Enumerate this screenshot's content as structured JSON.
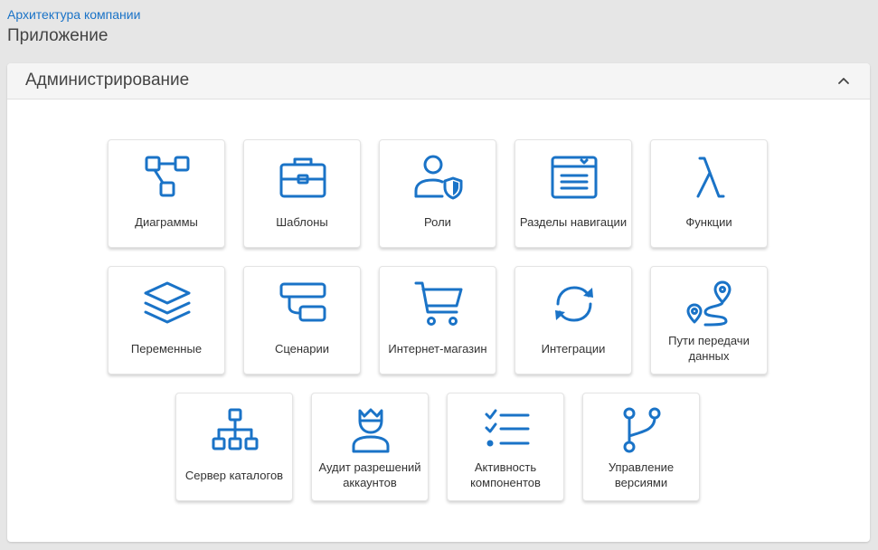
{
  "breadcrumb": "Архитектура компании",
  "page_title": "Приложение",
  "panel": {
    "title": "Администрирование",
    "toggle_icon": "chevron-up-icon"
  },
  "colors": {
    "accent": "#1a73c7",
    "background": "#e6e6e6",
    "panel_header": "#f5f5f5"
  },
  "tiles": [
    {
      "label": "Диаграммы",
      "icon": "diagram-nodes-icon"
    },
    {
      "label": "Шаблоны",
      "icon": "briefcase-icon"
    },
    {
      "label": "Роли",
      "icon": "user-shield-icon"
    },
    {
      "label": "Разделы навигации",
      "icon": "navigation-window-icon"
    },
    {
      "label": "Функции",
      "icon": "lambda-icon"
    },
    {
      "label": "Переменные",
      "icon": "layers-icon"
    },
    {
      "label": "Сценарии",
      "icon": "scenario-blocks-icon"
    },
    {
      "label": "Интернет-магазин",
      "icon": "shopping-cart-icon"
    },
    {
      "label": "Интеграции",
      "icon": "sync-arrows-icon"
    },
    {
      "label": "Пути передачи данных",
      "icon": "route-pins-icon"
    },
    {
      "label": "Сервер каталогов",
      "icon": "hierarchy-tree-icon"
    },
    {
      "label": "Аудит разрешений аккаунтов",
      "icon": "crowned-user-icon"
    },
    {
      "label": "Активность компонентов",
      "icon": "checklist-icon"
    },
    {
      "label": "Управление версиями",
      "icon": "version-branch-icon"
    }
  ]
}
